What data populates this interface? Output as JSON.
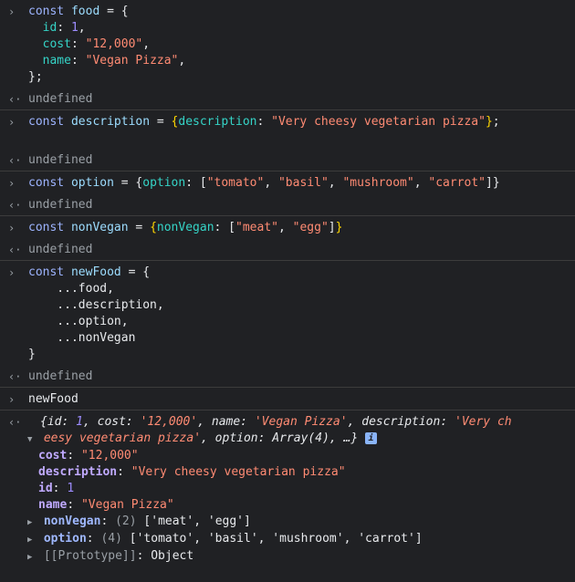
{
  "console": {
    "entry1": {
      "lines": [
        "const food = {",
        "  id: 1,",
        "  cost: \"12,000\",",
        "  name: \"Vegan Pizza\",",
        "};"
      ],
      "result": "undefined"
    },
    "entry2": {
      "code": "const description = {description: \"Very cheesy vegetarian pizza\"};",
      "result": "undefined"
    },
    "entry3": {
      "code": "const option = {option: [\"tomato\", \"basil\", \"mushroom\", \"carrot\"]}",
      "result": "undefined"
    },
    "entry4": {
      "code": "const nonVegan = {nonVegan: [\"meat\", \"egg\"]}",
      "result": "undefined"
    },
    "entry5": {
      "lines": [
        "const newFood = {",
        "    ...food,",
        "    ...description,",
        "    ...option,",
        "    ...nonVegan",
        "}"
      ],
      "result": "undefined"
    },
    "entry6": {
      "code": "newFood"
    },
    "output": {
      "preview_line1": "{id: 1, cost: '12,000', name: 'Vegan Pizza', description: 'Very ch",
      "preview_line2": "eesy vegetarian pizza', option: Array(4), …}",
      "info_badge": "i",
      "props": [
        {
          "key": "cost",
          "value": "\"12,000\""
        },
        {
          "key": "description",
          "value": "\"Very cheesy vegetarian pizza\""
        },
        {
          "key": "id",
          "value": "1"
        },
        {
          "key": "name",
          "value": "\"Vegan Pizza\""
        }
      ],
      "nonVegan": {
        "key": "nonVegan",
        "count": "(2)",
        "value": "['meat', 'egg']"
      },
      "option": {
        "key": "option",
        "count": "(4)",
        "value": "['tomato', 'basil', 'mushroom', 'carrot']"
      },
      "prototype": {
        "key": "[[Prototype]]",
        "value": "Object"
      }
    }
  },
  "icons": {
    "prompt": "›",
    "result": "‹·",
    "expanded": "▼",
    "collapsed": "▶"
  }
}
